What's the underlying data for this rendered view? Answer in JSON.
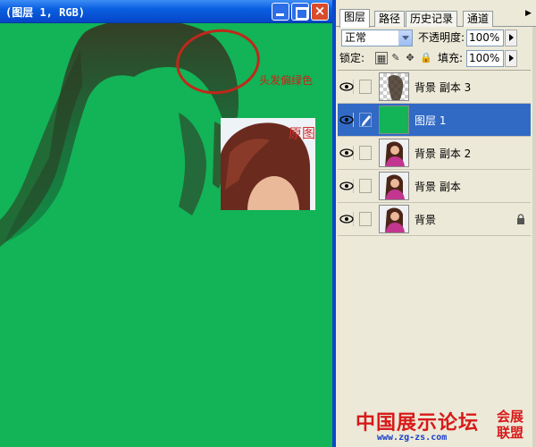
{
  "window": {
    "title": "(图层 1, RGB)",
    "controls": {
      "minimize": "minimize",
      "maximize": "maximize",
      "close": "×"
    }
  },
  "canvas": {
    "background_color": "#13b357",
    "annotation_label": "头发偏绿色",
    "annotation_color": "#c0281a",
    "original_label": "原图"
  },
  "layers_panel": {
    "tabs": [
      {
        "label": "图层",
        "active": true
      },
      {
        "label": "路径",
        "active": false
      },
      {
        "label": "历史记录",
        "active": false
      },
      {
        "label": "通道",
        "active": false
      }
    ],
    "blend_mode": "正常",
    "opacity_label": "不透明度:",
    "opacity_value": "100%",
    "lock_label": "锁定:",
    "fill_label": "填充:",
    "fill_value": "100%",
    "layers": [
      {
        "name": "背景 副本 3",
        "visible": true,
        "selected": false,
        "locked": false,
        "thumb": "transparent-hair"
      },
      {
        "name": "图层 1",
        "visible": true,
        "selected": true,
        "locked": false,
        "thumb": "solid-green"
      },
      {
        "name": "背景 副本 2",
        "visible": true,
        "selected": false,
        "locked": false,
        "thumb": "portrait"
      },
      {
        "name": "背景 副本",
        "visible": true,
        "selected": false,
        "locked": false,
        "thumb": "portrait"
      },
      {
        "name": "背景",
        "visible": true,
        "selected": false,
        "locked": true,
        "thumb": "portrait"
      }
    ],
    "selection_color": "#316ac5"
  },
  "watermark": {
    "main": "中国展示论坛",
    "url": "www.zg-zs.com",
    "side": "会展联盟"
  }
}
